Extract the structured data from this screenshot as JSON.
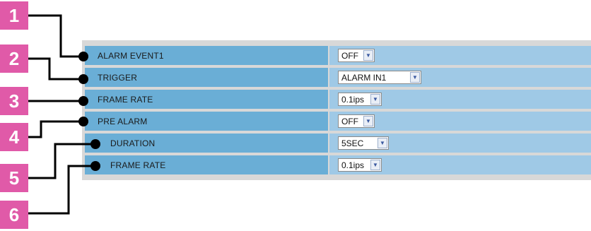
{
  "callouts": [
    "1",
    "2",
    "3",
    "4",
    "5",
    "6"
  ],
  "colors": {
    "badge": "#e05aa8",
    "label_cell": "#6aaed6",
    "value_cell": "#9fc9e6",
    "panel": "#d8d8d8"
  },
  "rows": [
    {
      "label": "ALARM EVENT1",
      "value": "OFF"
    },
    {
      "label": "TRIGGER",
      "value": "ALARM IN1"
    },
    {
      "label": "FRAME RATE",
      "value": "0.1ips"
    },
    {
      "label": "PRE ALARM",
      "value": "OFF"
    },
    {
      "label": "DURATION",
      "value": "5SEC"
    },
    {
      "label": "FRAME RATE",
      "value": "0.1ips"
    }
  ],
  "dropdown_icon": "chevron-down-icon"
}
